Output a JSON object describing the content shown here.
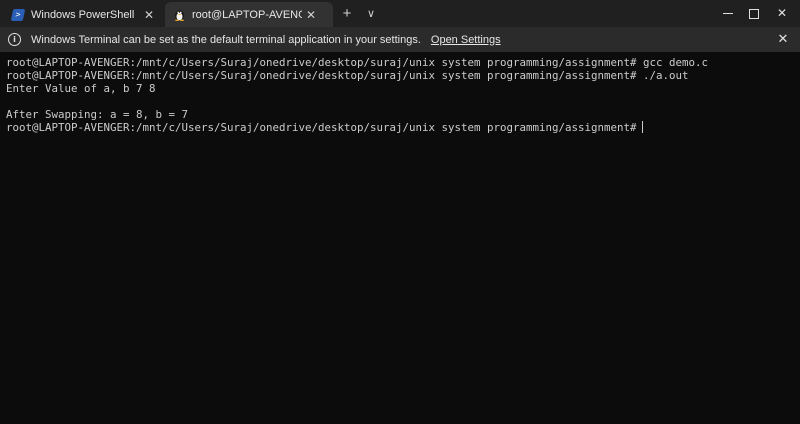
{
  "tabs": [
    {
      "title": "Windows PowerShell",
      "icon": "powershell-icon",
      "active": false
    },
    {
      "title": "root@LAPTOP-AVENGER: /mnt/",
      "icon": "tux-icon",
      "active": true
    }
  ],
  "titlebar": {
    "new_tab_glyph": "+",
    "dropdown_glyph": "∨",
    "close_glyph": "✕"
  },
  "infobar": {
    "message": "Windows Terminal can be set as the default terminal application in your settings.",
    "link": "Open Settings",
    "close_glyph": "✕"
  },
  "terminal": {
    "lines": [
      "root@LAPTOP-AVENGER:/mnt/c/Users/Suraj/onedrive/desktop/suraj/unix system programming/assignment# gcc demo.c",
      "root@LAPTOP-AVENGER:/mnt/c/Users/Suraj/onedrive/desktop/suraj/unix system programming/assignment# ./a.out",
      "Enter Value of a, b 7 8",
      "",
      "After Swapping: a = 8, b = 7",
      "root@LAPTOP-AVENGER:/mnt/c/Users/Suraj/onedrive/desktop/suraj/unix system programming/assignment#"
    ]
  },
  "colors": {
    "background": "#0c0c0c",
    "tabbar": "#202020",
    "active_tab": "#323232",
    "infobar": "#2b2b2b",
    "text": "#cccccc"
  }
}
